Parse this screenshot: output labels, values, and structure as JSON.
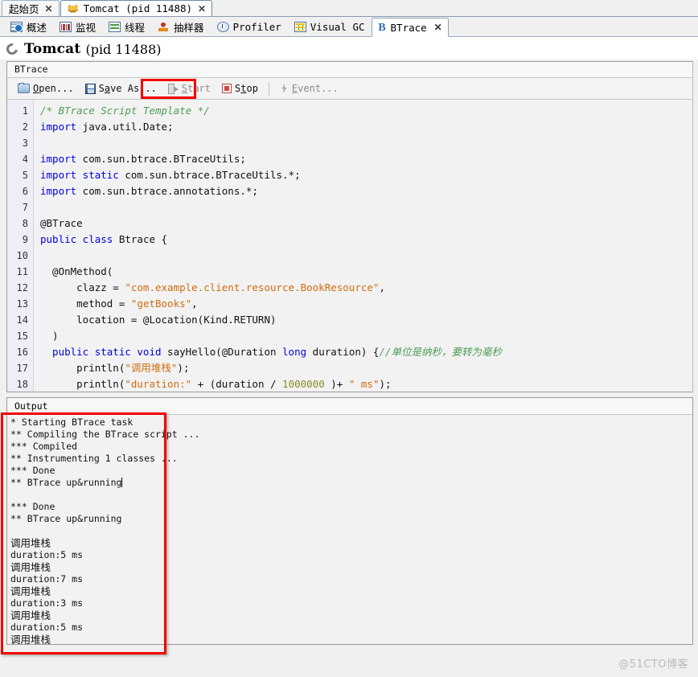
{
  "window_tabs": [
    {
      "label": "起始页",
      "icon": "none",
      "active": false,
      "closable": true
    },
    {
      "label": "Tomcat (pid 11488)",
      "icon": "cat-icon",
      "active": true,
      "closable": true
    }
  ],
  "feature_tabs": [
    {
      "label": "概述",
      "icon": "overview-icon",
      "active": false,
      "closable": false
    },
    {
      "label": "监视",
      "icon": "monitor-icon",
      "active": false,
      "closable": false
    },
    {
      "label": "线程",
      "icon": "threads-icon",
      "active": false,
      "closable": false
    },
    {
      "label": "抽样器",
      "icon": "sampler-icon",
      "active": false,
      "closable": false
    },
    {
      "label": "Profiler",
      "icon": "profiler-icon",
      "active": false,
      "closable": false
    },
    {
      "label": "Visual GC",
      "icon": "visualgc-icon",
      "active": false,
      "closable": false
    },
    {
      "label": "BTrace",
      "icon": "btrace-icon",
      "active": true,
      "closable": true
    }
  ],
  "header": {
    "title": "Tomcat",
    "subtitle": "(pid 11488)",
    "icon": "loading-spinner-icon"
  },
  "panel": {
    "title": "BTrace"
  },
  "toolbar": {
    "open_pre": "",
    "open_mn": "O",
    "open_post": "pen...",
    "save_pre": "S",
    "save_mn": "a",
    "save_post": "ve As...",
    "start_pre": "",
    "start_mn": "S",
    "start_post": "tart",
    "stop_pre": "S",
    "stop_mn": "t",
    "stop_post": "op",
    "event_pre": "",
    "event_mn": "E",
    "event_post": "vent...",
    "highlight_color": "#f40000"
  },
  "editor": {
    "line_numbers": [
      1,
      2,
      3,
      4,
      5,
      6,
      7,
      8,
      9,
      10,
      11,
      12,
      13,
      14,
      15,
      16,
      17,
      18
    ],
    "lines": [
      [
        {
          "t": "/* BTrace Script Template */",
          "c": "cm"
        }
      ],
      [
        {
          "t": "import",
          "c": "kw"
        },
        {
          "t": " java.util.Date;",
          "c": "pln"
        }
      ],
      [],
      [
        {
          "t": "import",
          "c": "kw"
        },
        {
          "t": " com.sun.btrace.BTraceUtils;",
          "c": "pln"
        }
      ],
      [
        {
          "t": "import static",
          "c": "kw"
        },
        {
          "t": " com.sun.btrace.BTraceUtils.*;",
          "c": "pln"
        }
      ],
      [
        {
          "t": "import",
          "c": "kw"
        },
        {
          "t": " com.sun.btrace.annotations.*;",
          "c": "pln"
        }
      ],
      [],
      [
        {
          "t": "@BTrace",
          "c": "pln"
        }
      ],
      [
        {
          "t": "public class",
          "c": "kw"
        },
        {
          "t": " Btrace {",
          "c": "pln"
        }
      ],
      [],
      [
        {
          "t": "  @OnMethod(",
          "c": "pln"
        }
      ],
      [
        {
          "t": "      clazz = ",
          "c": "pln"
        },
        {
          "t": "\"com.example.client.resource.BookResource\"",
          "c": "str"
        },
        {
          "t": ",",
          "c": "pln"
        }
      ],
      [
        {
          "t": "      method = ",
          "c": "pln"
        },
        {
          "t": "\"getBooks\"",
          "c": "str"
        },
        {
          "t": ",",
          "c": "pln"
        }
      ],
      [
        {
          "t": "      location = @Location(Kind.RETURN)",
          "c": "pln"
        }
      ],
      [
        {
          "t": "  )",
          "c": "pln"
        }
      ],
      [
        {
          "t": "  public static void",
          "c": "kw"
        },
        {
          "t": " sayHello(@Duration ",
          "c": "pln"
        },
        {
          "t": "long",
          "c": "kw"
        },
        {
          "t": " duration) {",
          "c": "pln"
        },
        {
          "t": "//单位是纳秒，要转为毫秒",
          "c": "cm"
        }
      ],
      [
        {
          "t": "      println(",
          "c": "pln"
        },
        {
          "t": "\"调用堆栈\"",
          "c": "str"
        },
        {
          "t": ");",
          "c": "pln"
        }
      ],
      [
        {
          "t": "      println(",
          "c": "pln"
        },
        {
          "t": "\"duration:\"",
          "c": "str"
        },
        {
          "t": " + (duration / ",
          "c": "pln"
        },
        {
          "t": "1000000",
          "c": "num"
        },
        {
          "t": " )+ ",
          "c": "pln"
        },
        {
          "t": "\" ms\"",
          "c": "str"
        },
        {
          "t": ");",
          "c": "pln"
        }
      ]
    ]
  },
  "output": {
    "title": "Output",
    "lines": [
      {
        "text": "* Starting BTrace task",
        "cjk": false,
        "caret": false
      },
      {
        "text": "** Compiling the BTrace script ...",
        "cjk": false,
        "caret": false
      },
      {
        "text": "*** Compiled",
        "cjk": false,
        "caret": false
      },
      {
        "text": "** Instrumenting 1 classes ...",
        "cjk": false,
        "caret": false
      },
      {
        "text": "*** Done",
        "cjk": false,
        "caret": false
      },
      {
        "text": "** BTrace up&running",
        "cjk": false,
        "caret": true
      },
      {
        "text": "",
        "cjk": false,
        "caret": false
      },
      {
        "text": "*** Done",
        "cjk": false,
        "caret": false
      },
      {
        "text": "** BTrace up&running",
        "cjk": false,
        "caret": false
      },
      {
        "text": "",
        "cjk": false,
        "caret": false
      },
      {
        "text": "调用堆栈",
        "cjk": true,
        "caret": false
      },
      {
        "text": "duration:5 ms",
        "cjk": false,
        "caret": false
      },
      {
        "text": "调用堆栈",
        "cjk": true,
        "caret": false
      },
      {
        "text": "duration:7 ms",
        "cjk": false,
        "caret": false
      },
      {
        "text": "调用堆栈",
        "cjk": true,
        "caret": false
      },
      {
        "text": "duration:3 ms",
        "cjk": false,
        "caret": false
      },
      {
        "text": "调用堆栈",
        "cjk": true,
        "caret": false
      },
      {
        "text": "duration:5 ms",
        "cjk": false,
        "caret": false
      },
      {
        "text": "调用堆栈",
        "cjk": true,
        "caret": false
      }
    ],
    "highlight_color": "#f40000"
  },
  "watermark": {
    "text": "@51CTO博客"
  }
}
